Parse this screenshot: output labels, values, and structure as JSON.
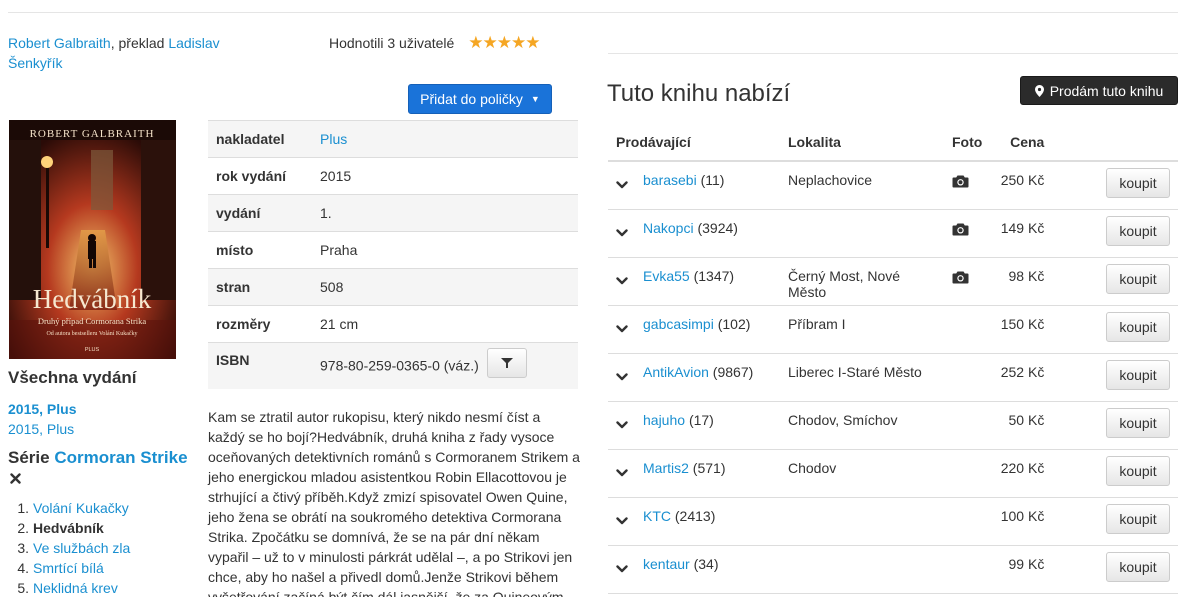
{
  "book": {
    "author": "Robert Galbraith",
    "translation_prefix": ", překlad ",
    "translator": "Ladislav Šenkyřík",
    "rating_text": "Hodnotili 3 uživatelé",
    "add_to_shelf": "Přidat do poličky",
    "cover": {
      "author_line": "ROBERT GALBRAITH",
      "title_line": "Hedvábník",
      "subtitle_line": "Druhý případ Cormorana Strika",
      "tagline": "Od autora bestselleru Volání Kukačky",
      "publisher_mark": "PLUS"
    }
  },
  "details": [
    {
      "key": "nakladatel",
      "value": "Plus",
      "link": true
    },
    {
      "key": "rok vydání",
      "value": "2015"
    },
    {
      "key": "vydání",
      "value": "1."
    },
    {
      "key": "místo",
      "value": "Praha"
    },
    {
      "key": "stran",
      "value": "508"
    },
    {
      "key": "rozměry",
      "value": "21 cm"
    },
    {
      "key": "ISBN",
      "value": "978-80-259-0365-0 (váz.)"
    }
  ],
  "editions": {
    "title": "Všechna vydání",
    "items": [
      "2015, Plus",
      "2015, Plus"
    ]
  },
  "series": {
    "prefix": "Série",
    "name": "Cormoran Strike",
    "items": [
      {
        "n": "1.",
        "title": "Volání Kukačky"
      },
      {
        "n": "2.",
        "title": "Hedvábník"
      },
      {
        "n": "3.",
        "title": "Ve službách zla"
      },
      {
        "n": "4.",
        "title": "Smrtící bílá"
      },
      {
        "n": "5.",
        "title": "Neklidná krev"
      }
    ]
  },
  "description": "Kam se ztratil autor rukopisu, který nikdo nesmí číst a každý se ho bojí?Hedvábník, druhá kniha z řady vysoce oceňovaných detektivních románů s Cormoranem Strikem a jeho energickou mladou asistentkou Robin Ellacottovou je strhující a čtivý příběh.Když zmizí spisovatel Owen Quine, jeho žena se obrátí na soukromého detektiva Cormorana Strika. Zpočátku se domnívá, že se na pár dní někam vypařil – už to v minulosti párkrát udělal –, a po Strikovi jen chce, aby ho našel a přivedl domů.Jenže Strikovi během vyšetřování začíná být čím dál jasnější, že za Quineovým",
  "offers": {
    "title": "Tuto knihu nabízí",
    "sell_button": "Prodám tuto knihu",
    "headers": {
      "seller": "Prodávající",
      "location": "Lokalita",
      "photo": "Foto",
      "price": "Cena"
    },
    "buy_label": "koupit",
    "rows": [
      {
        "seller": "barasebi",
        "count": "(11)",
        "location": "Neplachovice",
        "photo": true,
        "price": "250 Kč"
      },
      {
        "seller": "Nakopci",
        "count": "(3924)",
        "location": "",
        "photo": true,
        "price": "149 Kč"
      },
      {
        "seller": "Evka55",
        "count": "(1347)",
        "location": "Černý Most, Nové Město",
        "photo": true,
        "price": "98 Kč"
      },
      {
        "seller": "gabcasimpi",
        "count": "(102)",
        "location": "Příbram I",
        "photo": false,
        "price": "150 Kč"
      },
      {
        "seller": "AntikAvion",
        "count": "(9867)",
        "location": "Liberec I-Staré Město",
        "photo": false,
        "price": "252 Kč"
      },
      {
        "seller": "hajuho",
        "count": "(17)",
        "location": "Chodov, Smíchov",
        "photo": false,
        "price": "50 Kč"
      },
      {
        "seller": "Martis2",
        "count": "(571)",
        "location": "Chodov",
        "photo": false,
        "price": "220 Kč"
      },
      {
        "seller": "KTC",
        "count": "(2413)",
        "location": "",
        "photo": false,
        "price": "100 Kč"
      },
      {
        "seller": "kentaur",
        "count": "(34)",
        "location": "",
        "photo": false,
        "price": "99 Kč"
      }
    ]
  },
  "colors": {
    "link": "#1a8fd0",
    "primary_button": "#1a73d9",
    "dark_button": "#2b2b2b",
    "star": "#f5a623"
  },
  "icons": {
    "star": "star-icon",
    "chevron": "chevron-down-icon",
    "camera": "camera-icon",
    "filter": "filter-icon",
    "pin": "map-pin-icon",
    "remove": "close-icon"
  }
}
